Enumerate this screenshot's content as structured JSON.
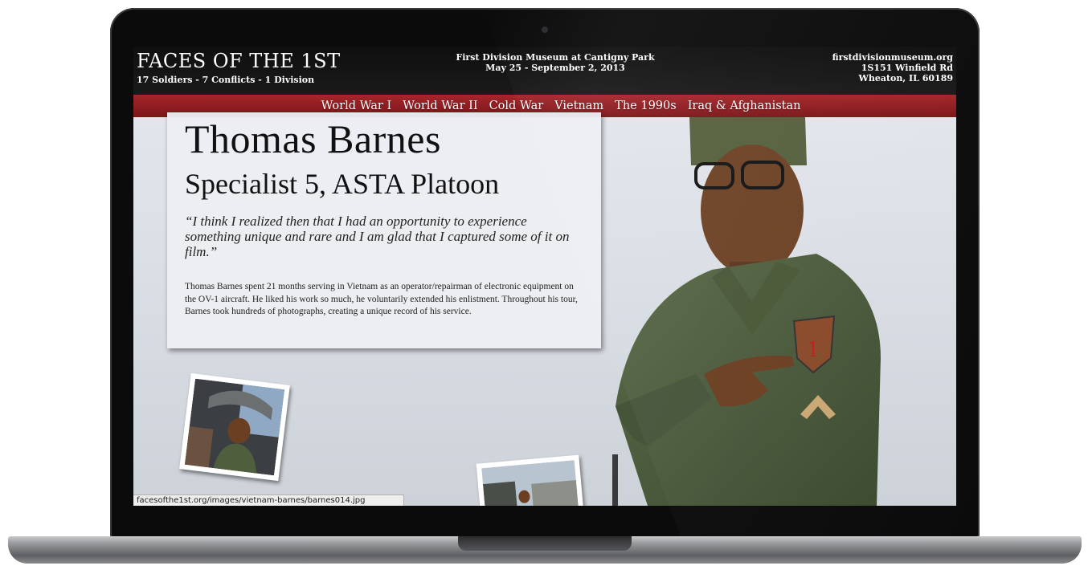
{
  "site": {
    "title": "FACES OF THE 1ST",
    "tagline": "17 Soldiers - 7 Conflicts - 1 Division",
    "venue_line1": "First Division Museum at Cantigny Park",
    "venue_line2": "May 25 - September 2, 2013",
    "address_line1": "firstdivisionmuseum.org",
    "address_line2": "1S151 Winfield Rd",
    "address_line3": "Wheaton, IL 60189"
  },
  "nav": {
    "items": [
      "World War I",
      "World War II",
      "Cold War",
      "Vietnam",
      "The 1990s",
      "Iraq & Afghanistan"
    ]
  },
  "soldier": {
    "name": "Thomas Barnes",
    "rank": "Specialist 5, ASTA Platoon",
    "quote": "“I think I realized then that I had an opportunity to experience something unique and rare and I am glad that I captured some of it on film.”",
    "bio": "Thomas Barnes spent 21 months serving in Vietnam as an operator/repairman of electronic equipment on the OV-1 aircraft. He liked his work so much, he voluntarily extended his enlistment. Throughout his tour, Barnes took hundreds of photographs, creating a unique record of his service."
  },
  "status": {
    "url": "facesofthe1st.org/images/vietnam-barnes/barnes014.jpg"
  },
  "colors": {
    "nav_red": "#9b1f23",
    "header_black": "#111111"
  }
}
